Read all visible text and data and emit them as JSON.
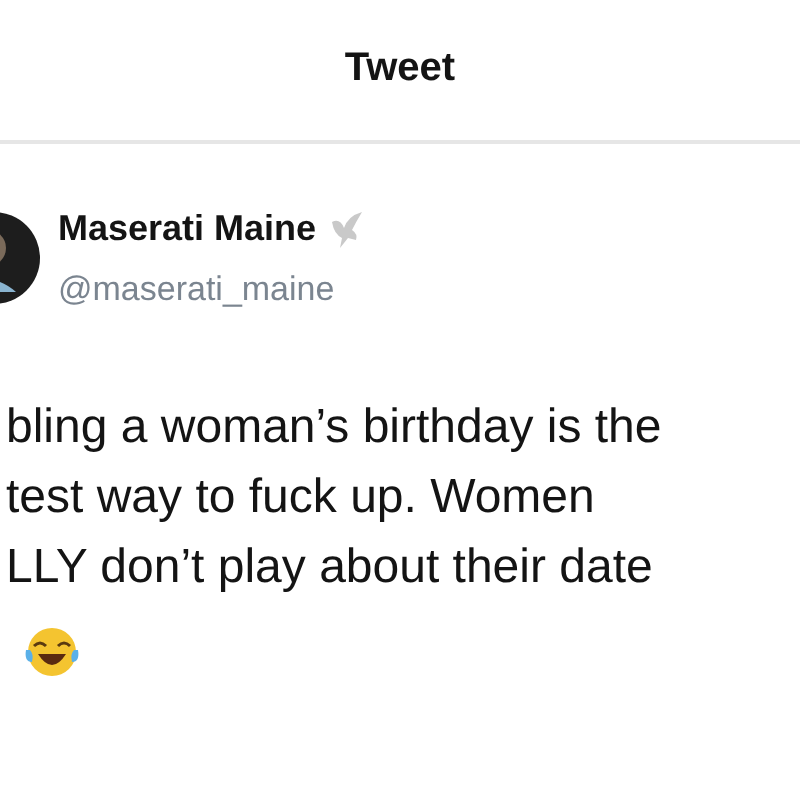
{
  "header": {
    "title": "Tweet"
  },
  "tweet": {
    "author": {
      "name": "Maserati Maine",
      "handle": "@maserati_maine"
    },
    "lines": [
      "bling a woman’s birthday is the",
      "test way to fuck up. Women",
      "LLY don’t play about their date"
    ]
  }
}
